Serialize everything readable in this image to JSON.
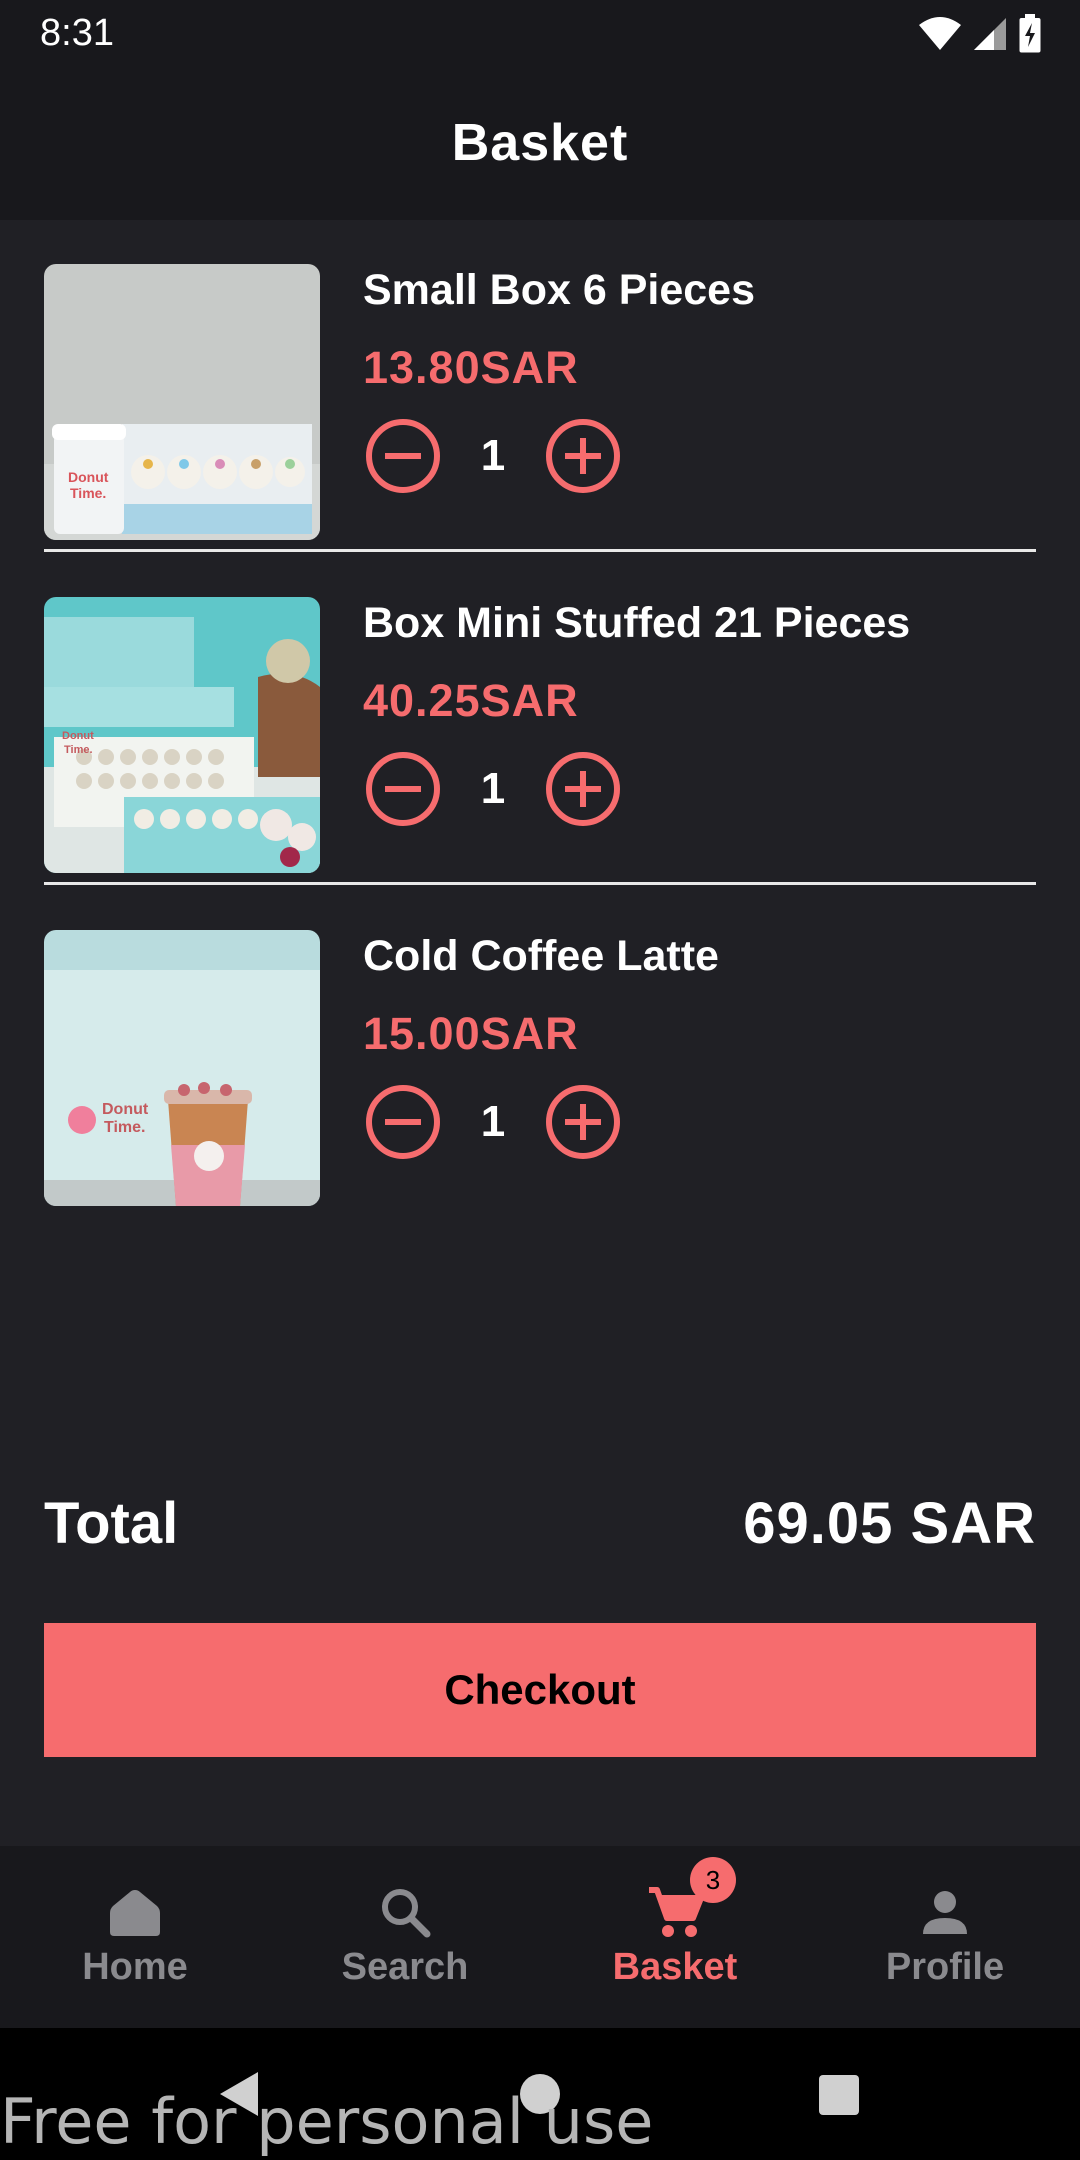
{
  "status_bar": {
    "time": "8:31"
  },
  "app_bar": {
    "title": "Basket"
  },
  "items": [
    {
      "name": "Small Box 6 Pieces",
      "price": "13.80SAR",
      "quantity": "1"
    },
    {
      "name": "Box Mini Stuffed 21 Pieces",
      "price": "40.25SAR",
      "quantity": "1"
    },
    {
      "name": "Cold Coffee Latte",
      "price": "15.00SAR",
      "quantity": "1"
    }
  ],
  "summary": {
    "total_label": "Total",
    "total_value": "69.05 SAR"
  },
  "checkout": {
    "label": "Checkout"
  },
  "bottom_nav": {
    "items": [
      {
        "label": "Home",
        "icon": "home-icon"
      },
      {
        "label": "Search",
        "icon": "search-icon"
      },
      {
        "label": "Basket",
        "icon": "cart-icon",
        "active": true
      },
      {
        "label": "Profile",
        "icon": "person-icon"
      }
    ],
    "basket_badge": "3"
  },
  "watermark": "Free for personal use",
  "colors": {
    "accent": "#f66c6e",
    "background": "#202025",
    "bar": "#18181c",
    "inactive": "#8a8a8e"
  }
}
